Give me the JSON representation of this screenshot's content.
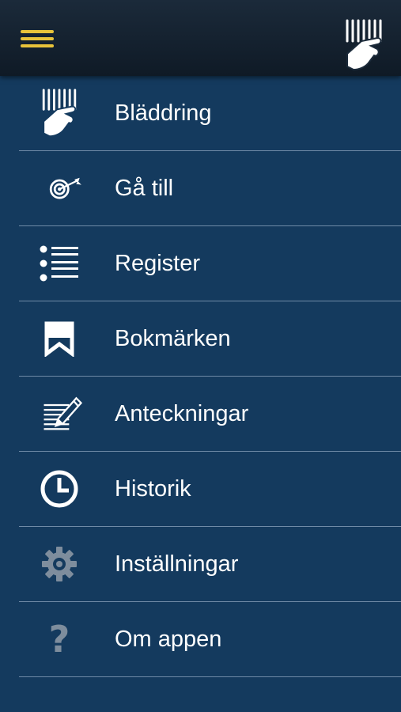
{
  "header": {
    "menu_icon": "hamburger-menu-icon",
    "logo_icon": "hand-pointing-bars-logo",
    "accent_color": "#e8c33a",
    "background_color": "#143a5e"
  },
  "menu": {
    "items": [
      {
        "label": "Bläddring",
        "icon": "hand-pointing-bars-icon"
      },
      {
        "label": "Gå till",
        "icon": "target-arrow-icon"
      },
      {
        "label": "Register",
        "icon": "list-icon"
      },
      {
        "label": "Bokmärken",
        "icon": "bookmark-icon"
      },
      {
        "label": "Anteckningar",
        "icon": "notes-pencil-icon"
      },
      {
        "label": "Historik",
        "icon": "clock-icon"
      },
      {
        "label": "Inställningar",
        "icon": "gear-icon"
      },
      {
        "label": "Om appen",
        "icon": "question-mark-icon"
      }
    ]
  }
}
